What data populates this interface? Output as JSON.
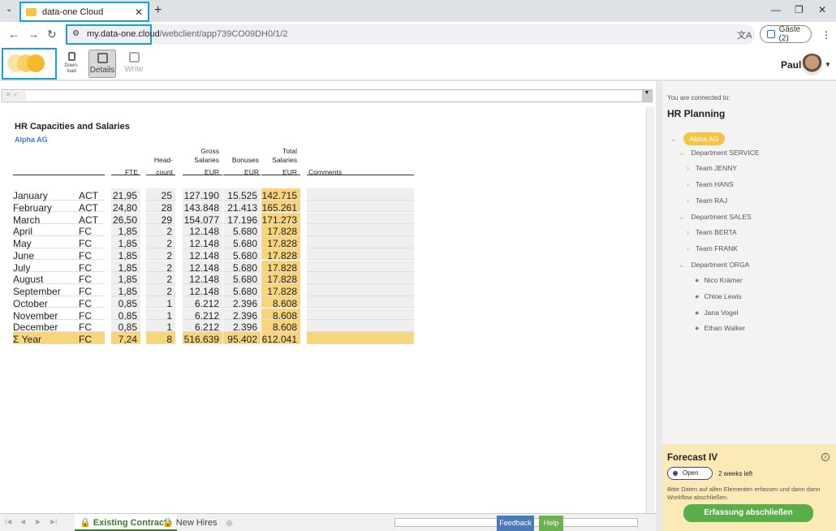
{
  "browser": {
    "tab_title": "data-one Cloud",
    "url_host": "my.data-one.cloud",
    "url_path": "/webclient/app739CO09DH0/1/2",
    "guest_label": "Gäste (2)"
  },
  "toolbar": {
    "download_label": "Down-\nload",
    "details_label": "Details",
    "write_label": "Write",
    "user_name": "Paul"
  },
  "report": {
    "title": "HR Capacities and Salaries",
    "company": "Alpha AG",
    "headers": {
      "fte": "FTE",
      "head1": "Head-",
      "head2": "count",
      "gross1": "Gross",
      "gross2": "Salaries",
      "gross3": "EUR",
      "bon2": "Bonuses",
      "bon3": "EUR",
      "tot1": "Total",
      "tot2": "Salaries",
      "tot3": "EUR",
      "comments": "Comments"
    },
    "rows": [
      {
        "month": "January",
        "type": "ACT",
        "fte": "21,95",
        "head": "25",
        "gross": "127.190",
        "bonus": "15.525",
        "total": "142.715"
      },
      {
        "month": "February",
        "type": "ACT",
        "fte": "24,80",
        "head": "28",
        "gross": "143.848",
        "bonus": "21.413",
        "total": "165.261"
      },
      {
        "month": "March",
        "type": "ACT",
        "fte": "26,50",
        "head": "29",
        "gross": "154.077",
        "bonus": "17.196",
        "total": "171.273"
      },
      {
        "month": "April",
        "type": "FC",
        "fte": "1,85",
        "head": "2",
        "gross": "12.148",
        "bonus": "5.680",
        "total": "17.828"
      },
      {
        "month": "May",
        "type": "FC",
        "fte": "1,85",
        "head": "2",
        "gross": "12.148",
        "bonus": "5.680",
        "total": "17.828"
      },
      {
        "month": "June",
        "type": "FC",
        "fte": "1,85",
        "head": "2",
        "gross": "12.148",
        "bonus": "5.680",
        "total": "17.828"
      },
      {
        "month": "July",
        "type": "FC",
        "fte": "1,85",
        "head": "2",
        "gross": "12.148",
        "bonus": "5.680",
        "total": "17.828"
      },
      {
        "month": "August",
        "type": "FC",
        "fte": "1,85",
        "head": "2",
        "gross": "12.148",
        "bonus": "5.680",
        "total": "17.828"
      },
      {
        "month": "September",
        "type": "FC",
        "fte": "1,85",
        "head": "2",
        "gross": "12.148",
        "bonus": "5.680",
        "total": "17.828"
      },
      {
        "month": "October",
        "type": "FC",
        "fte": "0,85",
        "head": "1",
        "gross": "6.212",
        "bonus": "2.396",
        "total": "8.608"
      },
      {
        "month": "November",
        "type": "FC",
        "fte": "0,85",
        "head": "1",
        "gross": "6.212",
        "bonus": "2.396",
        "total": "8.608"
      },
      {
        "month": "December",
        "type": "FC",
        "fte": "0,85",
        "head": "1",
        "gross": "6.212",
        "bonus": "2.396",
        "total": "8.608"
      }
    ],
    "sum": {
      "month": "Σ Year",
      "type": "FC",
      "fte": "7,24",
      "head": "8",
      "gross": "516.639",
      "bonus": "95.402",
      "total": "612.041"
    }
  },
  "sheets": {
    "existing": "Existing Contracts",
    "new": "New Hires",
    "feedback": "Feedback",
    "help": "Help"
  },
  "panel": {
    "connected": "You are connected to:",
    "title": "HR Planning",
    "tree": [
      {
        "label": "Alpha AG",
        "level": 0,
        "kind": "pill"
      },
      {
        "label": "Department SERVICE",
        "level": 1,
        "kind": "open"
      },
      {
        "label": "Team JENNY",
        "level": 2,
        "kind": "closed"
      },
      {
        "label": "Team HANS",
        "level": 2,
        "kind": "closed"
      },
      {
        "label": "Team RAJ",
        "level": 2,
        "kind": "closed"
      },
      {
        "label": "Department SALES",
        "level": 1,
        "kind": "open"
      },
      {
        "label": "Team BERTA",
        "level": 2,
        "kind": "closed"
      },
      {
        "label": "Team FRANK",
        "level": 2,
        "kind": "closed"
      },
      {
        "label": "Department ORGA",
        "level": 1,
        "kind": "open"
      },
      {
        "label": "Nico Krämer",
        "level": 2,
        "kind": "person"
      },
      {
        "label": "Chloe Lewis",
        "level": 2,
        "kind": "person"
      },
      {
        "label": "Jana Vogel",
        "level": 2,
        "kind": "person"
      },
      {
        "label": "Ethan Walker",
        "level": 2,
        "kind": "person"
      }
    ]
  },
  "forecast": {
    "title": "Forecast IV",
    "status": "Open",
    "remaining": "2 weeks left",
    "description": "Bitte Daten auf allen Elementen erfassen und dann dann Workflow abschließen.",
    "button": "Erfassung abschließen"
  }
}
